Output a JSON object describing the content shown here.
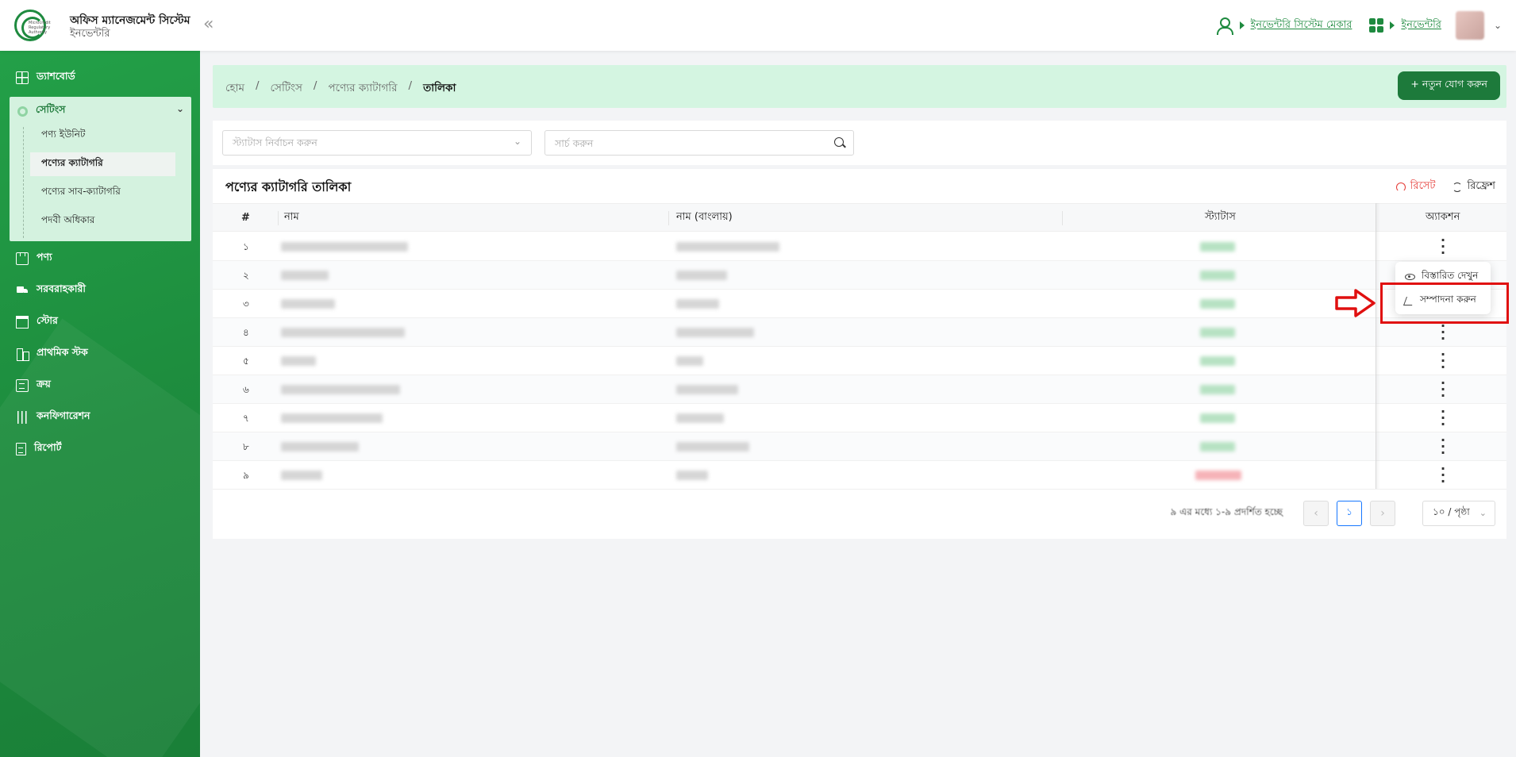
{
  "header": {
    "logo_text": "Microcredit Regulatory Authority",
    "app_title": "অফিস ম্যানেজমেন্ট সিস্টেম",
    "app_subtitle": "ইনভেন্টরি",
    "role_link": "ইনভেন্টরি সিস্টেম মেকার",
    "module_link": "ইনভেন্টরি"
  },
  "sidebar": {
    "dashboard": "ড্যাশবোর্ড",
    "settings": "সেটিংস",
    "settings_items": [
      {
        "label": "পণ্য ইউনিট"
      },
      {
        "label": "পণ্যের ক্যাটাগরি"
      },
      {
        "label": "পণ্যের সাব-ক্যাটাগরি"
      },
      {
        "label": "পদবী অধিকার"
      }
    ],
    "items": [
      {
        "label": "পণ্য"
      },
      {
        "label": "সরবরাহকারী"
      },
      {
        "label": "স্টোর"
      },
      {
        "label": "প্রাথমিক স্টক"
      },
      {
        "label": "ক্রয়"
      },
      {
        "label": "কনফিগারেশন"
      },
      {
        "label": "রিপোর্ট"
      }
    ]
  },
  "breadcrumb": [
    "হোম",
    "সেটিংস",
    "পণ্যের ক্যাটাগরি",
    "তালিকা"
  ],
  "add_button": "+ নতুন যোগ করুন",
  "filters": {
    "status_placeholder": "স্ট্যাটাস নির্বাচন করুন",
    "search_placeholder": "সার্চ করুন"
  },
  "table": {
    "title": "পণ্যের ক্যাটাগরি তালিকা",
    "reset": "রিসেট",
    "refresh": "রিফ্রেশ",
    "headers": [
      "#",
      "নাম",
      "নাম (বাংলায়)",
      "স্ট্যাটাস",
      "অ্যাকশন"
    ],
    "rows": [
      {
        "num": "১",
        "status_color": "#b7e2c3"
      },
      {
        "num": "২",
        "status_color": "#b7e2c3"
      },
      {
        "num": "৩",
        "status_color": "#b7e2c3"
      },
      {
        "num": "৪",
        "status_color": "#b7e2c3"
      },
      {
        "num": "৫",
        "status_color": "#b7e2c3"
      },
      {
        "num": "৬",
        "status_color": "#b7e2c3"
      },
      {
        "num": "৭",
        "status_color": "#b7e2c3"
      },
      {
        "num": "৮",
        "status_color": "#b7e2c3"
      },
      {
        "num": "৯",
        "status_color": "#f6b3b8"
      }
    ]
  },
  "action_menu": {
    "view": "বিস্তারিত দেখুন",
    "edit": "সম্পাদনা করুন"
  },
  "pagination": {
    "info": "৯ এর মধ্যে ১-৯ প্রদর্শিত হচ্ছে",
    "current_page": "১",
    "page_size": "১০ / পৃষ্ঠা"
  },
  "colors": {
    "primary": "#1d7a3b",
    "highlight": "#e01010"
  }
}
